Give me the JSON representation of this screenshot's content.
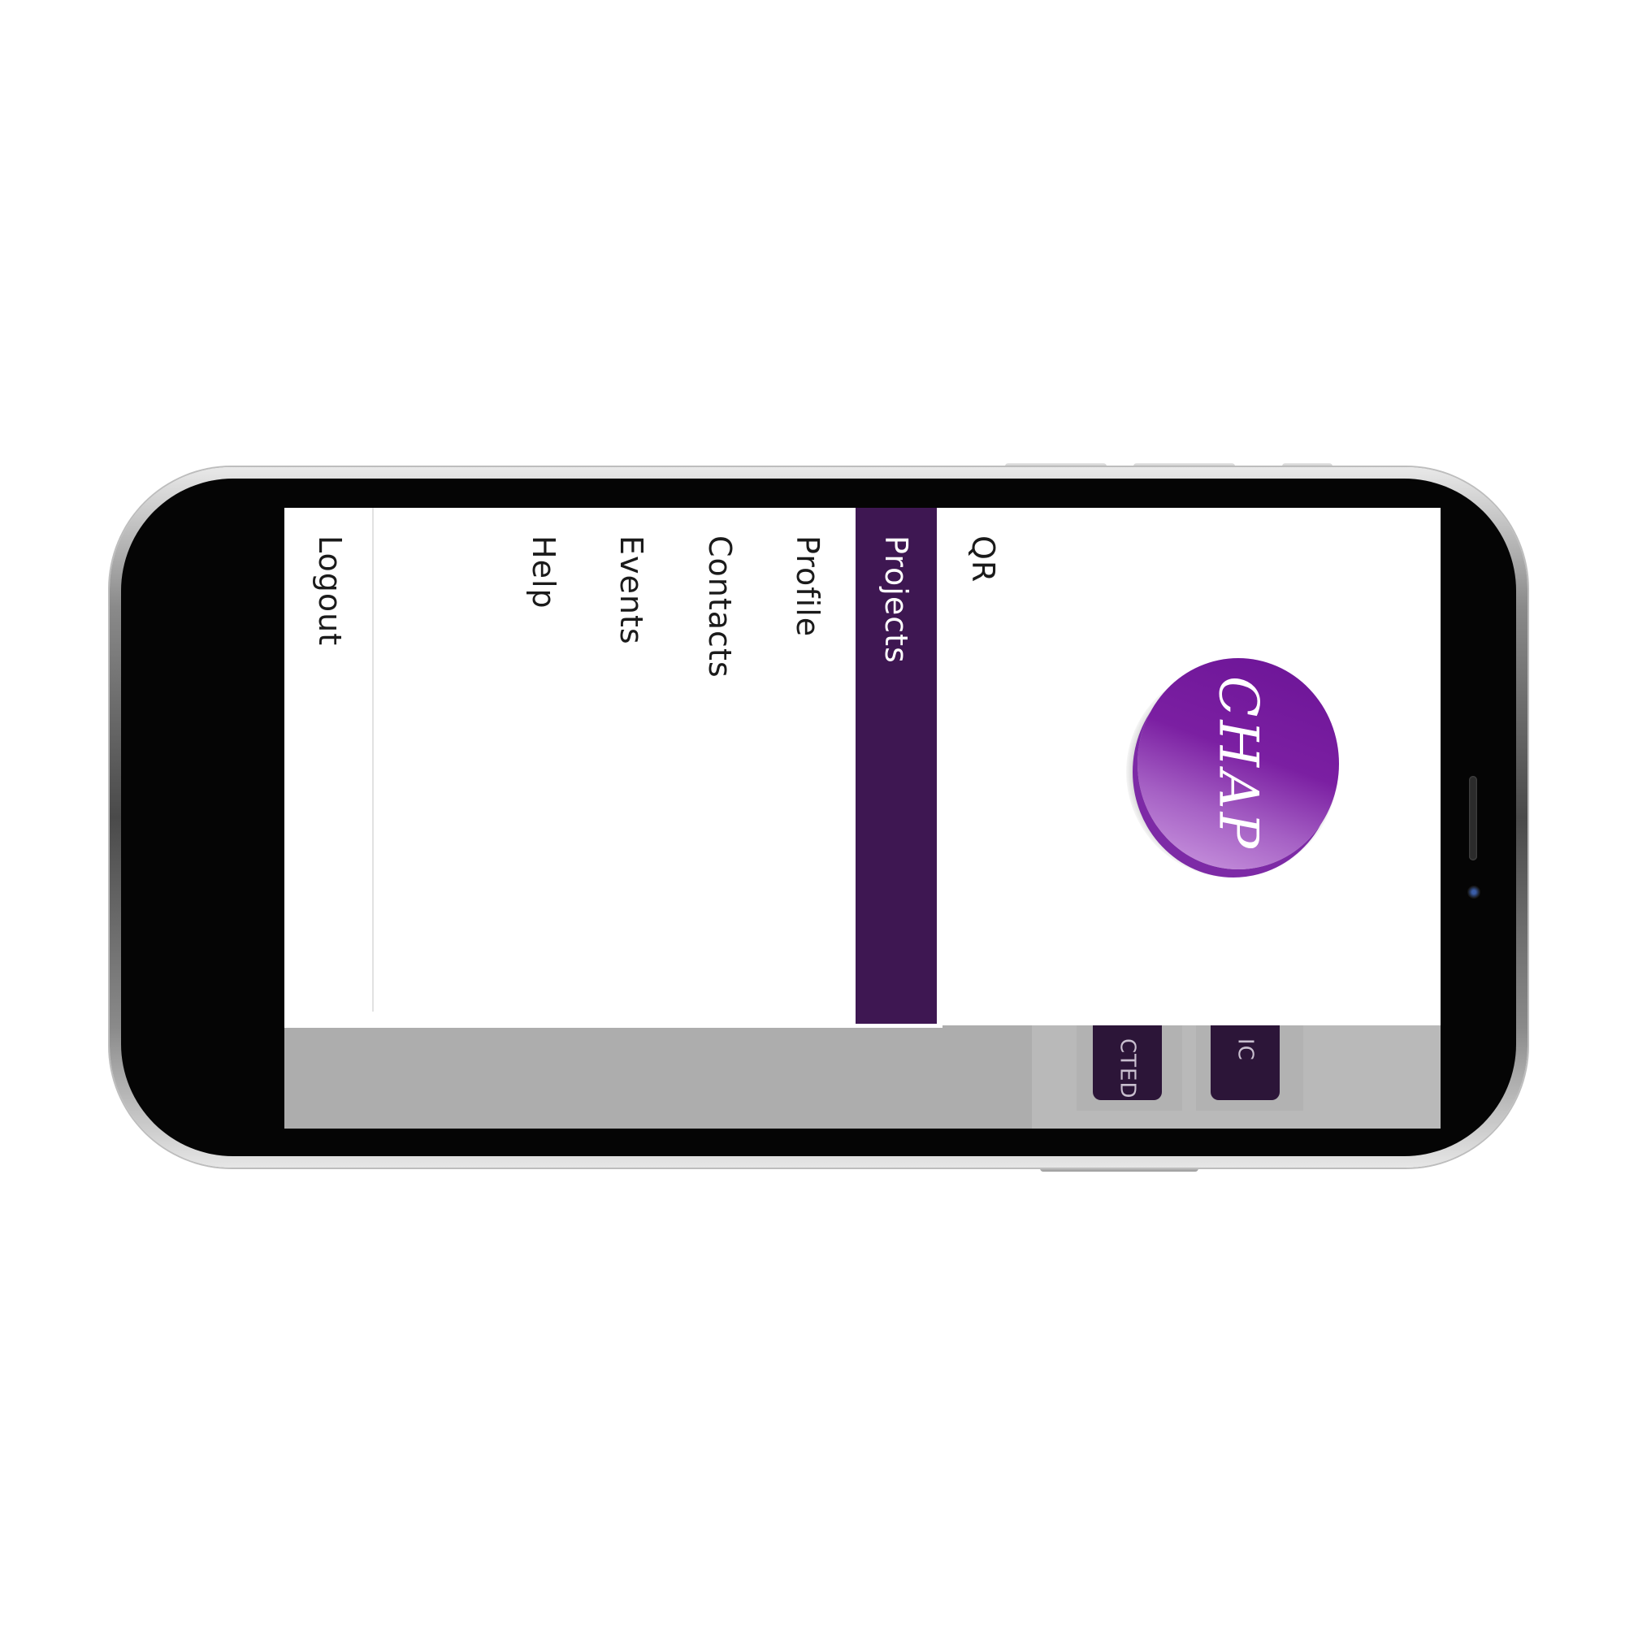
{
  "device": {
    "frame_color": "#4a4a4a",
    "screen_bg": "#ffffff"
  },
  "android_nav": {
    "back_icon": "triangle-back-icon",
    "home_icon": "circle-home-icon",
    "recents_icon": "square-recents-icon"
  },
  "drawer": {
    "active_color": "#3e1752",
    "items": [
      {
        "label": "QR",
        "active": false
      },
      {
        "label": "Projects",
        "active": true
      },
      {
        "label": "Profile",
        "active": false
      },
      {
        "label": "Contacts",
        "active": false
      },
      {
        "label": "Events",
        "active": false
      },
      {
        "label": "Help",
        "active": false
      },
      {
        "label": "Logout",
        "active": false
      }
    ]
  },
  "logo": {
    "text": "CHAP",
    "color": "#7b1fa2"
  },
  "tabs": {
    "chip_color": "#2c1538",
    "items": [
      {
        "label": "IC"
      },
      {
        "label": "CTED"
      }
    ]
  }
}
